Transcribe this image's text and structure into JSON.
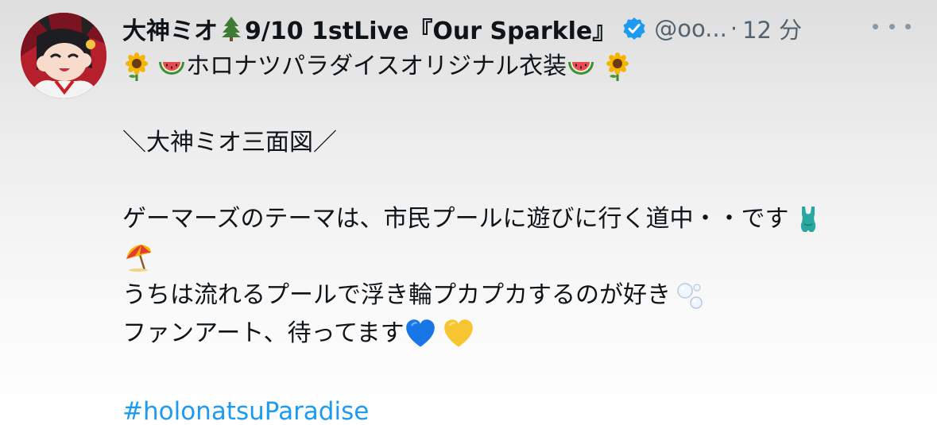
{
  "author": {
    "name_part1": "大神ミオ",
    "name_part2": "9/10 1stLive『Our Sparkle』",
    "handle": "@oo...",
    "separator": "·",
    "time": "12 分"
  },
  "icons": {
    "avatar": "avatar-illustration",
    "name_emoji": "evergreen-tree-icon",
    "verified": "verified-badge-icon",
    "more": "more-options-icon"
  },
  "colors": {
    "link": "#1d9bf0",
    "verified": "#1d9bf0",
    "secondary_text": "#536471"
  },
  "tweet": {
    "line1_text": "ホロナツパラダイスオリジナル衣装",
    "line2_text": "＼大神ミオ三面図／",
    "line3_text": "ゲーマーズのテーマは、市民プールに遊びに行く道中・・です",
    "line5_text": "うちは流れるプールで浮き輪プカプカするのが好き",
    "line6_text": "ファンアート、待ってます",
    "hashtag": "#holonatsuParadise"
  }
}
